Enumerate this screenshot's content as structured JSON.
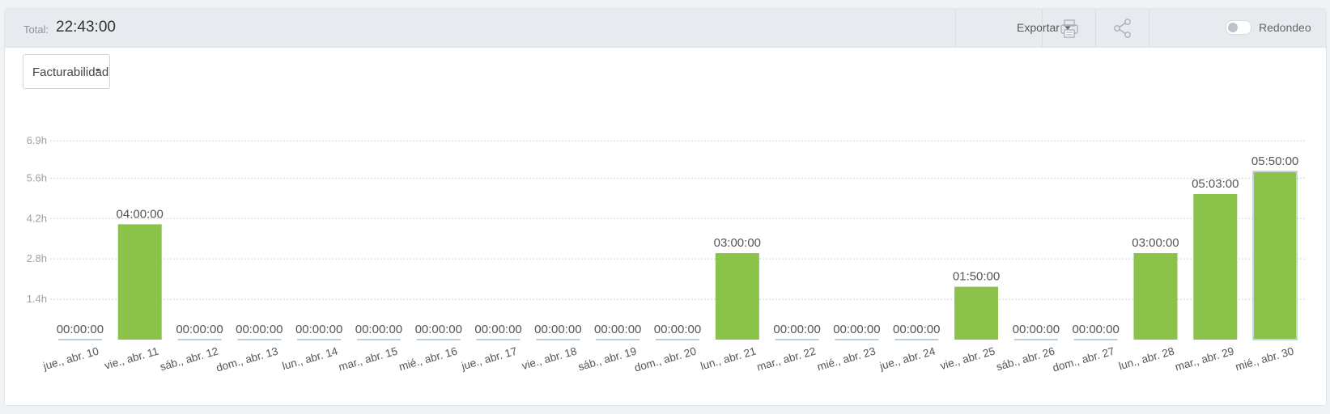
{
  "header": {
    "total_label": "Total:",
    "total_value": "22:43:00",
    "export_label": "Exportar",
    "print_icon": "printer-icon",
    "share_icon": "share-icon",
    "rounding_label": "Redondeo",
    "rounding_on": false
  },
  "filter": {
    "selected": "Facturabilidad"
  },
  "colors": {
    "bar": "#8bc34a",
    "zero": "#b9cfe0",
    "grid": "#cfd6dc",
    "tick": "#9aa3ab",
    "label": "#555555"
  },
  "chart_data": {
    "type": "bar",
    "categories": [
      "jue., abr. 10",
      "vie., abr. 11",
      "sáb., abr. 12",
      "dom., abr. 13",
      "lun., abr. 14",
      "mar., abr. 15",
      "mié., abr. 16",
      "jue., abr. 17",
      "vie., abr. 18",
      "sáb., abr. 19",
      "dom., abr. 20",
      "lun., abr. 21",
      "mar., abr. 22",
      "mié., abr. 23",
      "jue., abr. 24",
      "vie., abr. 25",
      "sáb., abr. 26",
      "dom., abr. 27",
      "lun., abr. 28",
      "mar., abr. 29",
      "mié., abr. 30"
    ],
    "values": [
      0,
      4.0,
      0,
      0,
      0,
      0,
      0,
      0,
      0,
      0,
      0,
      3.0,
      0,
      0,
      0,
      1.8333,
      0,
      0,
      3.0,
      5.05,
      5.8333
    ],
    "data_labels": [
      "00:00:00",
      "04:00:00",
      "00:00:00",
      "00:00:00",
      "00:00:00",
      "00:00:00",
      "00:00:00",
      "00:00:00",
      "00:00:00",
      "00:00:00",
      "00:00:00",
      "03:00:00",
      "00:00:00",
      "00:00:00",
      "00:00:00",
      "01:50:00",
      "00:00:00",
      "00:00:00",
      "03:00:00",
      "05:03:00",
      "05:50:00"
    ],
    "yticks": [
      1.4,
      2.8,
      4.2,
      5.6,
      6.9
    ],
    "ytick_labels": [
      "1.4h",
      "2.8h",
      "4.2h",
      "5.6h",
      "6.9h"
    ],
    "ylim": [
      0,
      6.9
    ],
    "grid": true,
    "highlighted_index": 20
  }
}
